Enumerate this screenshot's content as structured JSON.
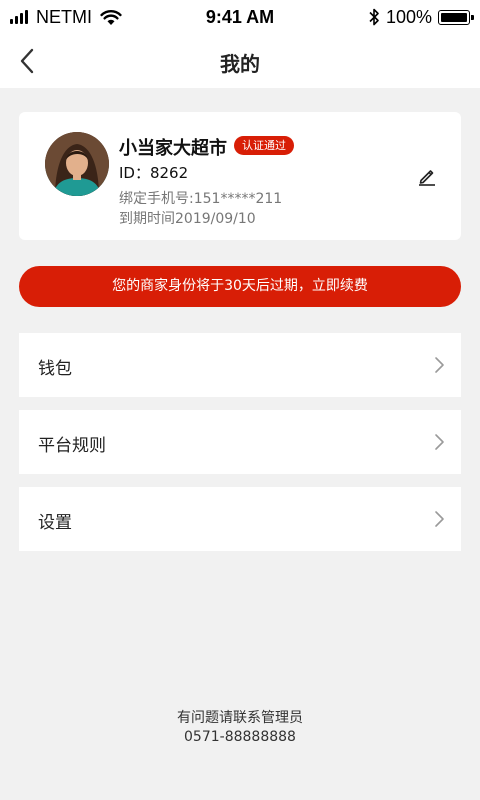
{
  "status_bar": {
    "carrier": "NETMI",
    "time": "9:41 AM",
    "battery_percent": "100%"
  },
  "nav": {
    "title": "我的",
    "back_icon": "chevron-left-icon"
  },
  "profile": {
    "shop_name": "小当家大超市",
    "badge": "认证通过",
    "id_line": "ID：8262",
    "phone_line": "绑定手机号:151*****211",
    "expire_line": "到期时间2019/09/10",
    "edit_icon": "pencil-icon"
  },
  "renew_banner": {
    "text": "您的商家身份将于30天后过期，立即续费"
  },
  "menu": {
    "items": [
      {
        "label": "钱包"
      },
      {
        "label": "平台规则"
      },
      {
        "label": "设置"
      }
    ]
  },
  "footer": {
    "help_text": "有问题请联系管理员",
    "phone": "0571-88888888"
  },
  "colors": {
    "accent": "#d81e06",
    "background": "#f1f1f1",
    "card": "#ffffff"
  }
}
